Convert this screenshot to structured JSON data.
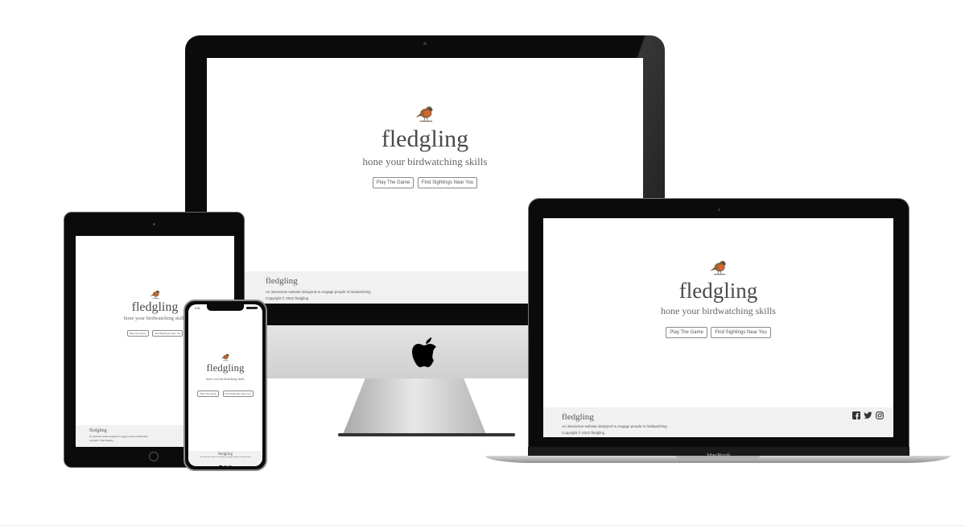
{
  "site": {
    "brand": "fledgling",
    "tagline": "hone your birdwatching skills",
    "buttons": [
      "Play The Game",
      "Find Sightings Near You"
    ],
    "footer": {
      "brand": "fledgling",
      "description": "An interactive website designed to engage people in birdwatching",
      "copyright": "Copyright © 2022 fledgling"
    },
    "social_icons": [
      "facebook-icon",
      "twitter-icon",
      "instagram-icon"
    ]
  },
  "devices": {
    "laptop_label": "MacBook",
    "phone_status_time": "9:41"
  },
  "colors": {
    "bezel": "#0a0a0a",
    "footer_bg": "#f1f1f1",
    "text": "#4a4a4a",
    "robin_breast": "#d2691e"
  }
}
